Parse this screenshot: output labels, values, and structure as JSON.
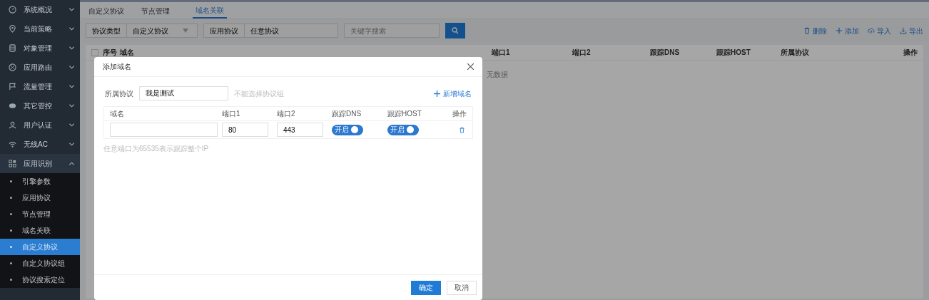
{
  "sidebar": {
    "items": [
      {
        "label": "系统概况",
        "expanded": false
      },
      {
        "label": "当前策略",
        "expanded": false
      },
      {
        "label": "对象管理",
        "expanded": false
      },
      {
        "label": "应用路由",
        "expanded": false
      },
      {
        "label": "流量管理",
        "expanded": false
      },
      {
        "label": "其它管控",
        "expanded": false
      },
      {
        "label": "用户认证",
        "expanded": false
      },
      {
        "label": "无线AC",
        "expanded": false
      },
      {
        "label": "应用识别",
        "expanded": true,
        "children": [
          {
            "label": "引擎参数",
            "selected": false
          },
          {
            "label": "应用协议",
            "selected": false
          },
          {
            "label": "节点管理",
            "selected": false
          },
          {
            "label": "域名关联",
            "selected": false
          },
          {
            "label": "自定义协议",
            "selected": true
          },
          {
            "label": "自定义协议组",
            "selected": false
          },
          {
            "label": "协议搜索定位",
            "selected": false
          }
        ]
      }
    ]
  },
  "tabs": [
    {
      "label": "自定义协议",
      "selected": false
    },
    {
      "label": "节点管理",
      "selected": false
    },
    {
      "label": "域名关联",
      "selected": true
    }
  ],
  "filters": {
    "protocol_type_label": "协议类型",
    "protocol_type_value": "自定义协议",
    "app_protocol_label": "应用协议",
    "app_protocol_value": "任意协议",
    "search": {
      "placeholder": "关键字搜索"
    }
  },
  "actions": [
    "删除",
    "添加",
    "导入",
    "导出"
  ],
  "table": {
    "select_all": {
      "checked": false
    },
    "columns": [
      "序号",
      "域名",
      "端口1",
      "端口2",
      "跟踪DNS",
      "跟踪HOST",
      "所属协议",
      "操作"
    ],
    "empty_text": "无数据"
  },
  "dialog": {
    "title": "添加域名",
    "protocol_label": "所属协议",
    "protocol_value": "我是测试",
    "protocol_hint": "不能选择协议组",
    "add_link": "新增域名",
    "columns": [
      "域名",
      "端口1",
      "端口2",
      "跟踪DNS",
      "跟踪HOST",
      "操作"
    ],
    "rows": [
      {
        "domain": "",
        "port1": "80",
        "port2": "443",
        "track_dns": {
          "on": true,
          "label": "开启"
        },
        "track_host": {
          "on": true,
          "label": "开启"
        }
      }
    ],
    "note": "任意端口为65535表示跟踪整个IP",
    "buttons": [
      {
        "label": "确定",
        "kind": "primary"
      },
      {
        "label": "取消",
        "kind": "default"
      }
    ]
  }
}
